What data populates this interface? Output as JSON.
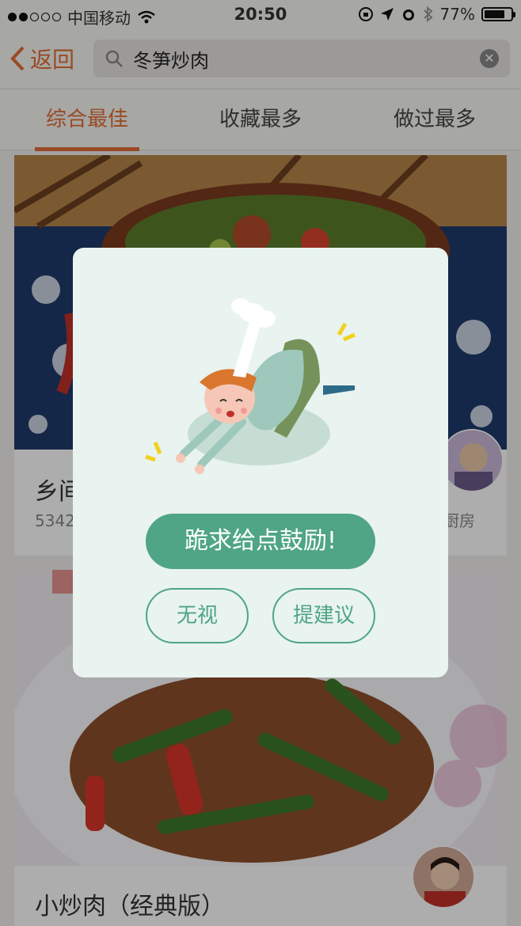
{
  "status_bar": {
    "carrier": "中国移动",
    "time": "20:50",
    "battery": "77%",
    "battery_level": 0.77
  },
  "nav": {
    "back_label": "返回",
    "search_value": "冬笋炒肉"
  },
  "tabs": [
    {
      "label": "综合最佳",
      "active": true
    },
    {
      "label": "收藏最多",
      "active": false
    },
    {
      "label": "做过最多",
      "active": false
    }
  ],
  "recipes": [
    {
      "title": "乡间",
      "meta": "5342",
      "author": "厨房"
    },
    {
      "title": "小炒肉（经典版）"
    }
  ],
  "dialog": {
    "primary_label": "跪求给点鼓励!",
    "ignore_label": "无视",
    "suggest_label": "提建议"
  },
  "colors": {
    "accent": "#e06d37",
    "dialog_green": "#4fa585",
    "dialog_bg": "#e9f3ef"
  }
}
